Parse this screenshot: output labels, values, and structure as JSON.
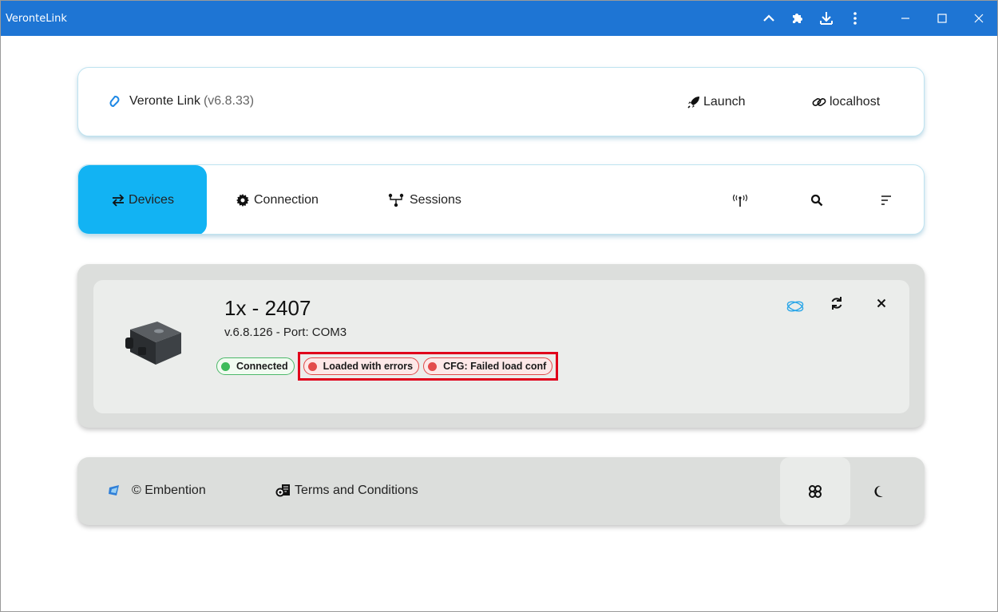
{
  "window": {
    "title": "VeronteLink"
  },
  "header": {
    "brand_name": "Veronte Link",
    "version": "(v6.8.33)",
    "launch_label": "Launch",
    "host_label": "localhost"
  },
  "nav": {
    "tabs": [
      {
        "label": "Devices",
        "active": true
      },
      {
        "label": "Connection"
      },
      {
        "label": "Sessions"
      }
    ]
  },
  "device": {
    "name": "1x - 2407",
    "subtitle": "v.6.8.126 - Port: COM3",
    "chips": [
      {
        "label": "Connected",
        "status": "ok"
      },
      {
        "label": "Loaded with errors",
        "status": "error"
      },
      {
        "label": "CFG: Failed load conf",
        "status": "error"
      }
    ]
  },
  "footer": {
    "company": "© Embention",
    "terms": "Terms and Conditions"
  },
  "colors": {
    "titlebar": "#1e75d4",
    "active_tab": "#12b3f3",
    "ok": "#3dbb5a",
    "error": "#e34c4c",
    "highlight": "#e0001b"
  }
}
